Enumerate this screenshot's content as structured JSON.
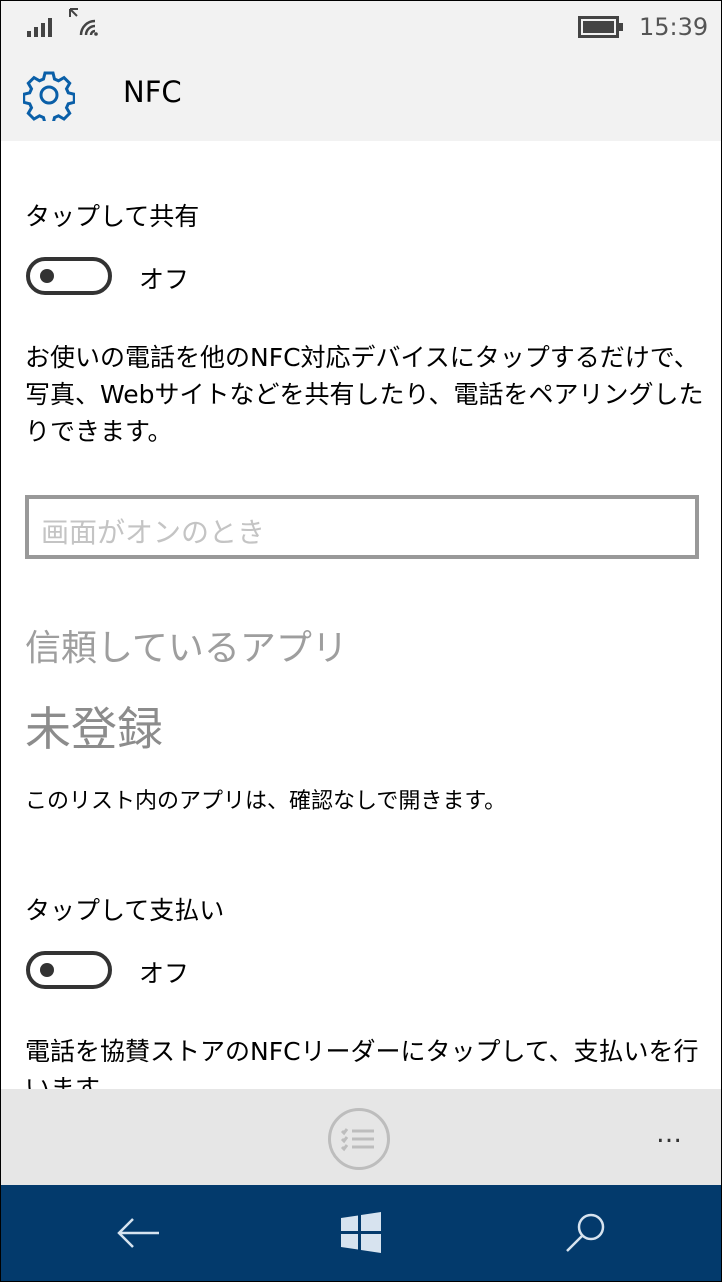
{
  "status_bar": {
    "time": "15:39",
    "icons": [
      "signal-icon",
      "wifi-icon",
      "battery-icon"
    ]
  },
  "header": {
    "title": "NFC",
    "icon": "gear-icon"
  },
  "tap_to_share": {
    "label": "タップして共有",
    "toggle_state": "オフ",
    "description": "お使いの電話を他のNFC対応デバイスにタップするだけで、写真、Webサイトなどを共有したり、電話をペアリングしたりできます。",
    "dropdown_placeholder": "画面がオンのとき"
  },
  "trusted_apps": {
    "heading": "信頼しているアプリ",
    "empty_text": "未登録",
    "description": "このリスト内のアプリは、確認なしで開きます。"
  },
  "tap_to_pay": {
    "label": "タップして支払い",
    "toggle_state": "オフ",
    "description": "電話を協賛ストアのNFCリーダーにタップして、支払いを行います。"
  },
  "app_bar": {
    "more_label": "…",
    "button_icon": "list-icon"
  },
  "nav_bar": {
    "buttons": [
      "back-icon",
      "windows-icon",
      "search-icon"
    ]
  },
  "colors": {
    "nav_bg": "#033a6c",
    "accent": "#0a5fa8",
    "header_bg": "#f2f2f2",
    "appbar_bg": "#e6e6e6"
  }
}
